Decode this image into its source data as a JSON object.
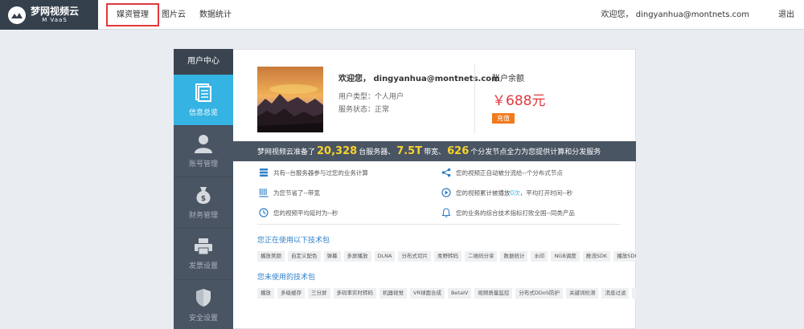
{
  "header": {
    "logo_title": "梦网视频云",
    "logo_sub": "M VaaS",
    "nav": [
      "媒资管理",
      "图片云",
      "数据统计"
    ],
    "welcome": "欢迎您， dingyanhua@montnets.com",
    "logout": "退出"
  },
  "sidebar": {
    "title": "用户中心",
    "items": [
      {
        "label": "信息总览",
        "icon": "document-icon"
      },
      {
        "label": "账号管理",
        "icon": "user-icon"
      },
      {
        "label": "财务管理",
        "icon": "money-bag-icon"
      },
      {
        "label": "发票设置",
        "icon": "printer-icon"
      },
      {
        "label": "安全设置",
        "icon": "shield-icon"
      }
    ]
  },
  "profile": {
    "welcome": "欢迎您， dingyanhua@montnets.com",
    "type": "用户类型：个人用户",
    "status": "服务状态：正常",
    "balance_label": "账户余额",
    "balance_value": "￥688元",
    "recharge": "充值"
  },
  "banner": {
    "p1": "梦网视频云准备了",
    "servers": "20,328",
    "p2": "台服务器、",
    "bandwidth": "7.5T",
    "p3": "带宽、",
    "nodes": "626",
    "p4": "个分发节点全力为您提供计算和分发服务"
  },
  "features": {
    "f1": "共有--台服务器参与过您的业务计算",
    "f2": "您的视频正自动被分流给--个分布式节点",
    "f3": "为您节省了--带宽",
    "f4a": "您的视频累计被播放",
    "f4b": "0次",
    "f4c": "，平均打开时间--秒",
    "f5": "您的视频平均延时为--秒",
    "f6": "您的业务的综合技术指标打败全国--同类产品"
  },
  "packages": {
    "used_title": "您正在使用以下技术包",
    "used": [
      "播放美颜",
      "自定义配色",
      "弹幕",
      "多屏播放",
      "DLNA",
      "分布式切片",
      "柔野转码",
      "二维码分享",
      "数据统计",
      "水印",
      "NGB调度",
      "推流SDK",
      "播放SDK"
    ],
    "unused_title": "您未使用的技术包",
    "unused": [
      "播放",
      "多级缓存",
      "三分屏",
      "多码率实时转码",
      "机器视觉",
      "VR球面合成",
      "BetaIV",
      "视频质量监控",
      "分布式DDoS防护",
      "关键词检测",
      "消息过滤",
      "RTSP"
    ]
  },
  "colors": {
    "accent": "#35b3e3",
    "sidebar": "#4a5563",
    "price": "#e0393e",
    "highlight": "#f7d32c",
    "recharge": "#f07a1d"
  }
}
